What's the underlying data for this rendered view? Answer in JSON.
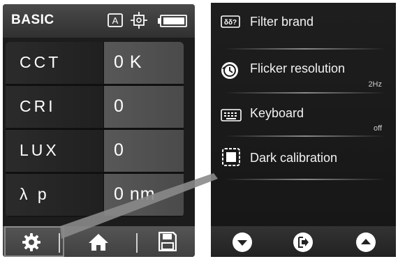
{
  "left_screen": {
    "title": "BASIC",
    "header_icons": [
      "auto-mode-icon",
      "target-crosshair-icon",
      "battery-icon"
    ],
    "auto_badge": "A",
    "rows": [
      {
        "label": "CCT",
        "value": "0 K"
      },
      {
        "label": "CRI",
        "value": "0"
      },
      {
        "label": "LUX",
        "value": "0"
      },
      {
        "label": "λ p",
        "value": "0 nm"
      }
    ],
    "footer": {
      "buttons": [
        "gear-icon",
        "home-icon",
        "save-icon"
      ]
    }
  },
  "right_screen": {
    "menu_items": [
      {
        "label": "Filter brand",
        "value": "",
        "icon": "filter-brand-icon"
      },
      {
        "label": "Flicker resolution",
        "value": "2Hz",
        "icon": "clock-history-icon"
      },
      {
        "label": "Keyboard",
        "value": "off",
        "icon": "keyboard-icon"
      },
      {
        "label": "Dark calibration",
        "value": "",
        "icon": "dark-calibration-icon"
      }
    ],
    "filter_icon_text": "δδ?",
    "footer": {
      "buttons": [
        "down-arrow-icon",
        "exit-icon",
        "up-arrow-icon"
      ]
    }
  },
  "colors": {
    "screen_bg": "#1c1c1c",
    "value_cell": "#525252",
    "text": "#ffffff"
  }
}
